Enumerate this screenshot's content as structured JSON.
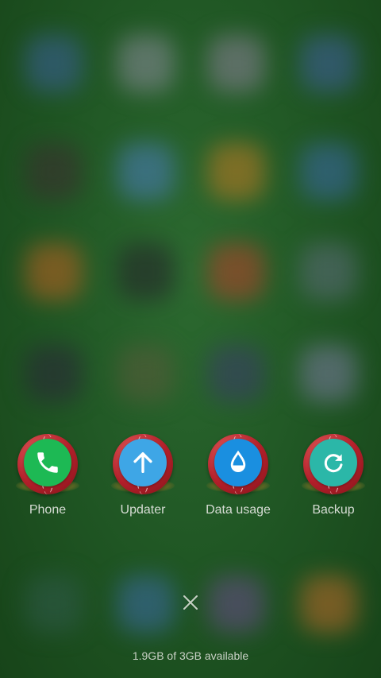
{
  "background": {
    "color": "#1f5523"
  },
  "apps": [
    {
      "label": "Phone",
      "icon": "phone-icon",
      "color": "#1db954"
    },
    {
      "label": "Updater",
      "icon": "arrow-up-icon",
      "color": "#3ea6e6"
    },
    {
      "label": "Data usage",
      "icon": "water-drop-icon",
      "color": "#1a8fe0"
    },
    {
      "label": "Backup",
      "icon": "refresh-icon",
      "color": "#2bb7a8"
    }
  ],
  "close": {
    "icon": "close-icon"
  },
  "memory": {
    "text": "1.9GB of 3GB available"
  }
}
